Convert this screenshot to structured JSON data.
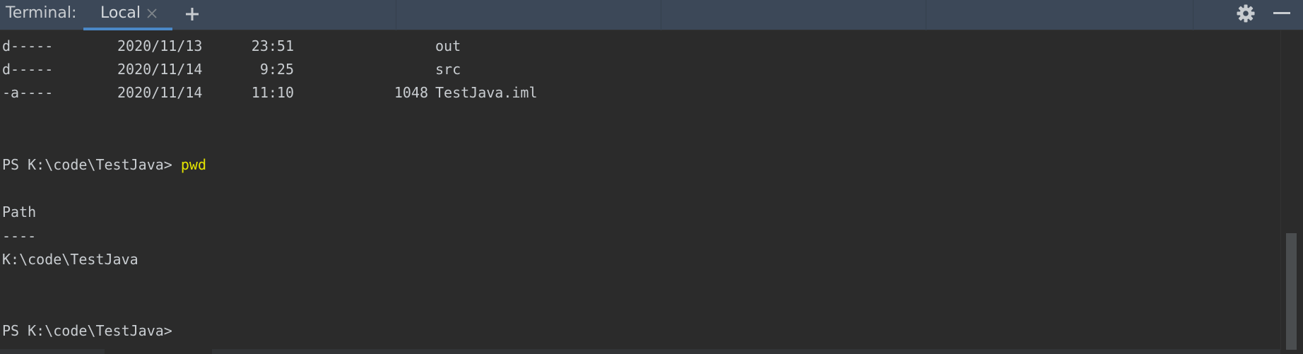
{
  "toolbar": {
    "title": "Terminal:",
    "tab_label": "Local",
    "close_icon": "close-icon",
    "add_icon": "plus-icon",
    "settings_icon": "gear-icon",
    "minimize_icon": "minimize-icon"
  },
  "listing": [
    {
      "mode": "d-----",
      "date": "2020/11/13",
      "time": "23:51",
      "length": "",
      "name": "out"
    },
    {
      "mode": "d-----",
      "date": "2020/11/14",
      "time": "9:25",
      "length": "",
      "name": "src"
    },
    {
      "mode": "-a----",
      "date": "2020/11/14",
      "time": "11:10",
      "length": "1048",
      "name": "TestJava.iml"
    }
  ],
  "prompt1": {
    "prompt": "PS K:\\code\\TestJava> ",
    "command": "pwd"
  },
  "output": {
    "header": "Path",
    "underline": "----",
    "value": "K:\\code\\TestJava"
  },
  "prompt2": {
    "prompt": "PS K:\\code\\TestJava>"
  },
  "colors": {
    "toolbar_bg": "#3c4858",
    "terminal_bg": "#2b2b2b",
    "text": "#c9cdd1",
    "command": "#e5e500",
    "tab_underline": "#4a88c7"
  }
}
